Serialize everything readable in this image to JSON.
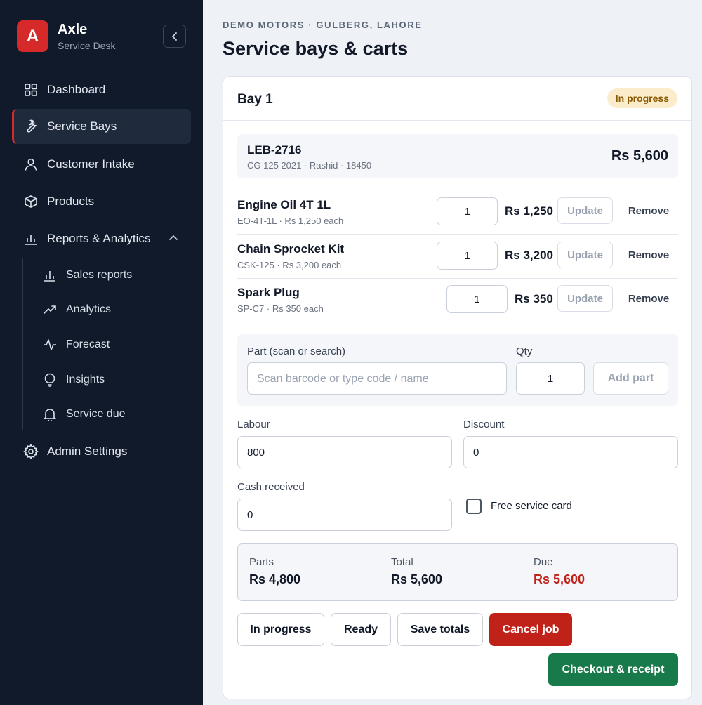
{
  "brand": {
    "logo_letter": "A",
    "name": "Axle",
    "subtitle": "Service Desk"
  },
  "sidebar": {
    "items": [
      {
        "label": "Dashboard",
        "icon": "grid-icon"
      },
      {
        "label": "Service Bays",
        "icon": "wrench-icon",
        "active": true
      },
      {
        "label": "Customer Intake",
        "icon": "user-icon"
      },
      {
        "label": "Products",
        "icon": "box-icon"
      },
      {
        "label": "Reports & Analytics",
        "icon": "bar-chart-icon",
        "expanded": true
      },
      {
        "label": "Admin Settings",
        "icon": "gear-icon"
      }
    ],
    "subitems": [
      {
        "label": "Sales reports",
        "icon": "bar-chart-icon"
      },
      {
        "label": "Analytics",
        "icon": "trending-up-icon"
      },
      {
        "label": "Forecast",
        "icon": "pulse-icon"
      },
      {
        "label": "Insights",
        "icon": "lightbulb-icon"
      },
      {
        "label": "Service due",
        "icon": "bell-icon"
      }
    ]
  },
  "header": {
    "eyebrow": "DEMO MOTORS · GULBERG, LAHORE",
    "title": "Service bays & carts"
  },
  "bay": {
    "title": "Bay 1",
    "status": "In progress",
    "vehicle": {
      "plate": "LEB-2716",
      "details": "CG 125 2021 · Rashid · 18450",
      "total": "Rs 5,600"
    },
    "lines": [
      {
        "name": "Engine Oil 4T 1L",
        "sub": "EO-4T-1L · Rs 1,250 each",
        "qty": "1",
        "price": "Rs 1,250"
      },
      {
        "name": "Chain Sprocket Kit",
        "sub": "CSK-125 · Rs 3,200 each",
        "qty": "1",
        "price": "Rs 3,200"
      },
      {
        "name": "Spark Plug",
        "sub": "SP-C7 · Rs 350 each",
        "qty": "1",
        "price": "Rs 350"
      }
    ],
    "line_buttons": {
      "update": "Update",
      "remove": "Remove"
    },
    "add_part": {
      "part_label": "Part (scan or search)",
      "part_placeholder": "Scan barcode or type code / name",
      "qty_label": "Qty",
      "qty_value": "1",
      "button": "Add part"
    },
    "labour": {
      "label": "Labour",
      "value": "800"
    },
    "discount": {
      "label": "Discount",
      "value": "0"
    },
    "cash": {
      "label": "Cash received",
      "value": "0"
    },
    "free_service": {
      "label": "Free service card",
      "checked": false
    },
    "summary": {
      "parts_label": "Parts",
      "parts": "Rs 4,800",
      "total_label": "Total",
      "total": "Rs 5,600",
      "due_label": "Due",
      "due": "Rs 5,600"
    },
    "actions": {
      "in_progress": "In progress",
      "ready": "Ready",
      "save_totals": "Save totals",
      "cancel": "Cancel job",
      "checkout": "Checkout & receipt"
    }
  },
  "colors": {
    "sidebar_bg": "#111a2b",
    "brand_red": "#d62a2a",
    "cancel_red": "#c0221a",
    "checkout_green": "#187a4a",
    "badge_bg": "#fbeccb"
  }
}
